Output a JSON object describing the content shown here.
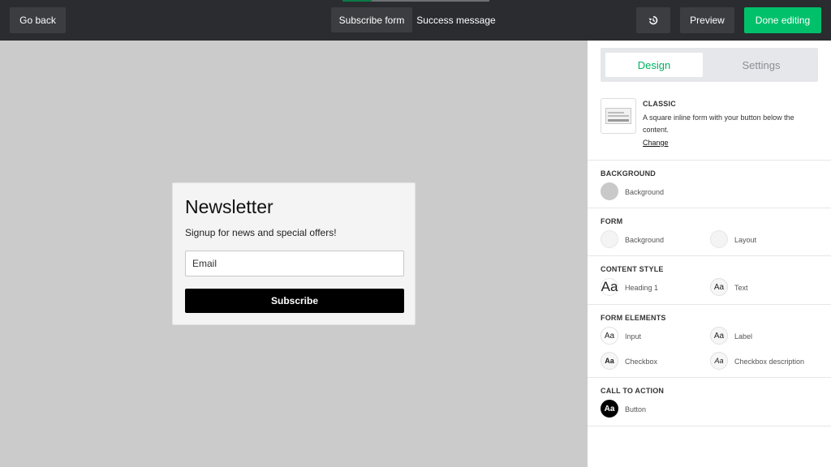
{
  "topbar": {
    "go_back": "Go back",
    "tab_subscribe": "Subscribe form",
    "tab_success": "Success message",
    "undo_icon": "history-icon",
    "preview": "Preview",
    "done": "Done editing"
  },
  "form": {
    "heading": "Newsletter",
    "subtitle": "Signup for news and special offers!",
    "email_placeholder": "Email",
    "button": "Subscribe"
  },
  "sidebar": {
    "tabs": {
      "design": "Design",
      "settings": "Settings"
    },
    "template": {
      "name": "CLASSIC",
      "description": "A square inline form with your button below the content.",
      "change": "Change"
    },
    "background": {
      "title": "BACKGROUND",
      "label": "Background",
      "color": "#c9c9c9"
    },
    "form_section": {
      "title": "FORM",
      "bg_label": "Background",
      "layout_label": "Layout"
    },
    "content_style": {
      "title": "CONTENT STYLE",
      "heading_label": "Heading 1",
      "text_label": "Text",
      "glyph_heading": "Aa",
      "glyph_text": "Aa"
    },
    "form_elements": {
      "title": "FORM ELEMENTS",
      "input_label": "Input",
      "label_label": "Label",
      "checkbox_label": "Checkbox",
      "checkbox_desc_label": "Checkbox description",
      "glyph": "Aa"
    },
    "cta": {
      "title": "CALL TO ACTION",
      "button_label": "Button",
      "glyph": "Aa"
    }
  },
  "colors": {
    "accent": "#00c16a",
    "topbar": "#2a2c30",
    "canvas": "#cbcbcb"
  }
}
